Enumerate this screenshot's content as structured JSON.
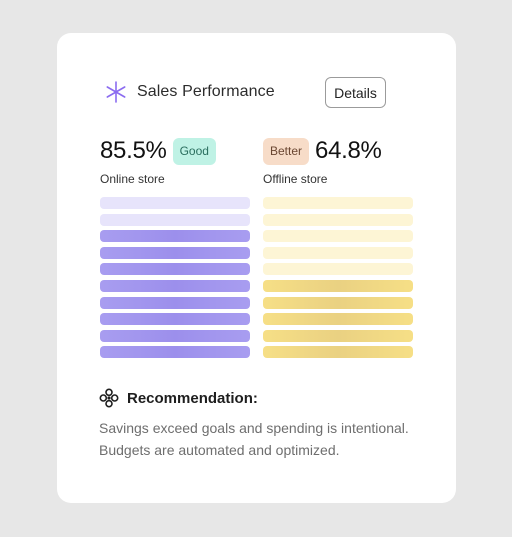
{
  "header": {
    "title": "Sales Performance",
    "icon": "asterisk-logo-icon",
    "details_label": "Details"
  },
  "online": {
    "value": "85.5%",
    "badge": "Good",
    "label": "Online store",
    "progress": 0.8
  },
  "offline": {
    "value": "64.8%",
    "badge": "Better",
    "label": "Offline store",
    "progress": 0.5
  },
  "recommendation": {
    "icon": "flower-icon",
    "title": "Recommendation:",
    "line1": "Savings exceed goals and spending is intentional.",
    "line2": "Budgets are automated and optimized."
  },
  "colors": {
    "accent": "#8b6cf0",
    "online_filled": "#a89df0",
    "online_empty": "#e7e4fb",
    "offline_filled": "#f6df86",
    "offline_empty": "#fdf5d5",
    "good_badge": "#bff2e5",
    "better_badge": "#f7dcc8"
  }
}
